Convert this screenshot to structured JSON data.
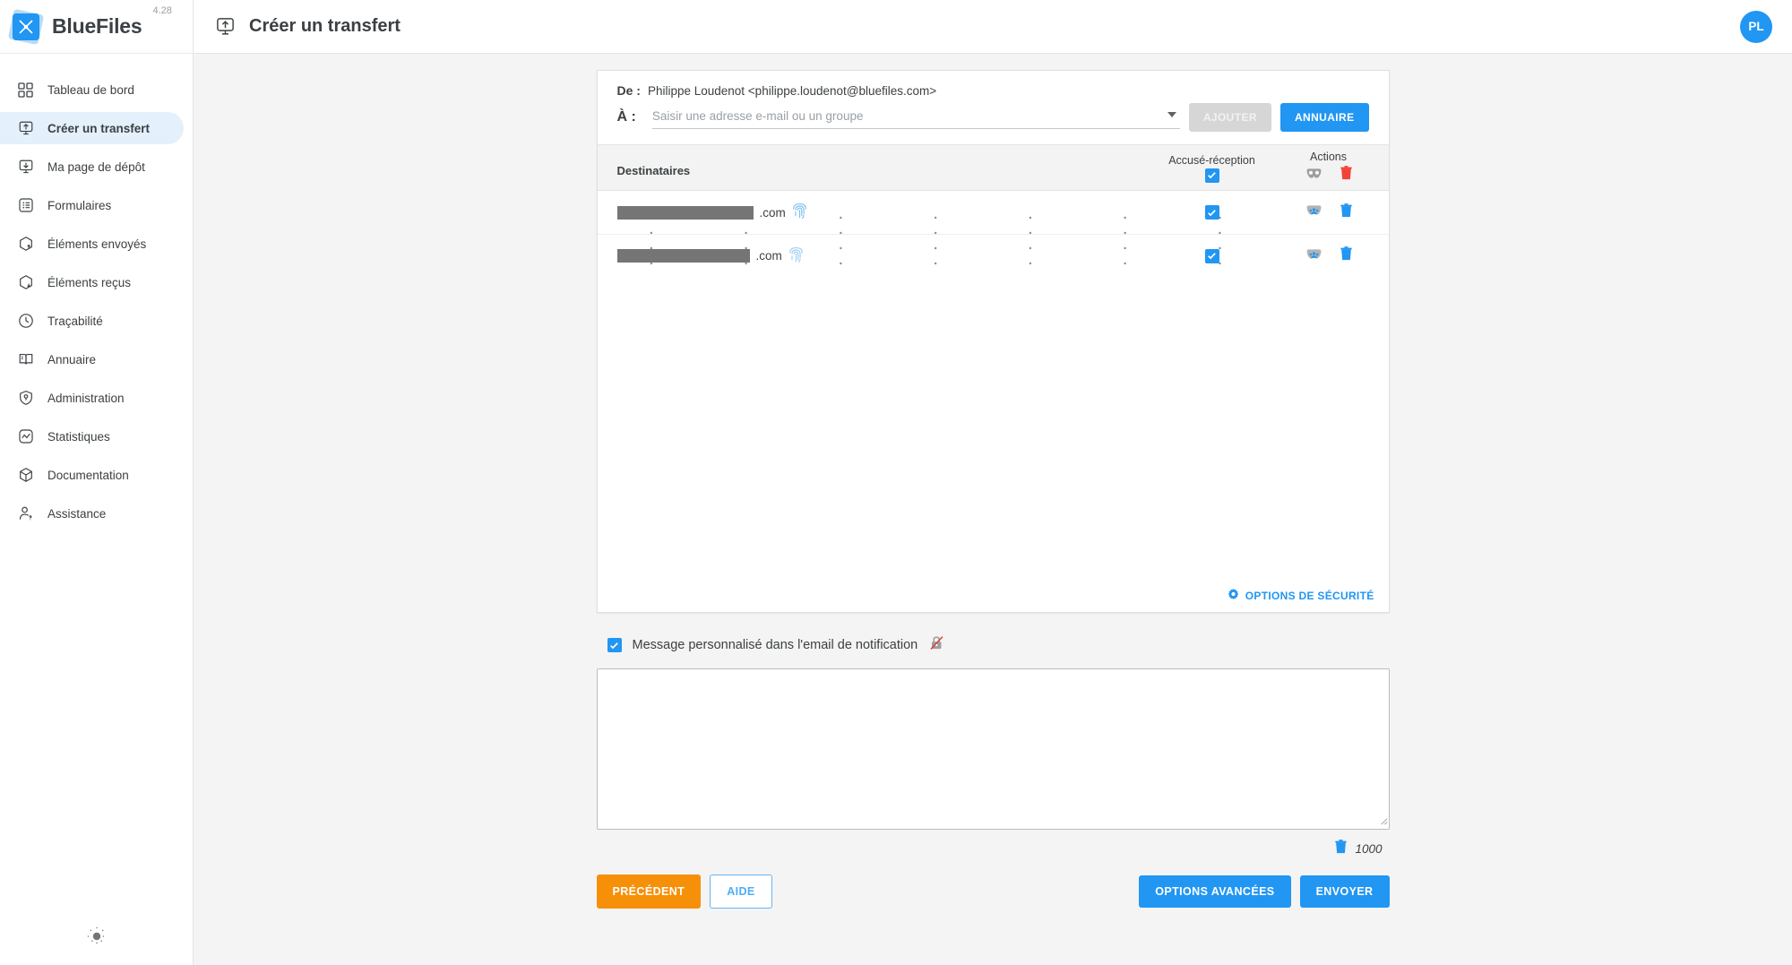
{
  "brand": {
    "name": "BlueFiles",
    "version": "4.28",
    "logo_icon": "bluefiles-x-logo"
  },
  "sidebar": {
    "items": [
      {
        "label": "Tableau de bord",
        "icon": "dashboard-grid-icon",
        "active": false
      },
      {
        "label": "Créer un transfert",
        "icon": "upload-monitor-icon",
        "active": true
      },
      {
        "label": "Ma page de dépôt",
        "icon": "download-monitor-icon",
        "active": false
      },
      {
        "label": "Formulaires",
        "icon": "list-form-icon",
        "active": false
      },
      {
        "label": "Éléments envoyés",
        "icon": "box-up-icon",
        "active": false
      },
      {
        "label": "Éléments reçus",
        "icon": "box-down-icon",
        "active": false
      },
      {
        "label": "Traçabilité",
        "icon": "clock-icon",
        "active": false
      },
      {
        "label": "Annuaire",
        "icon": "book-icon",
        "active": false
      },
      {
        "label": "Administration",
        "icon": "shield-key-icon",
        "active": false
      },
      {
        "label": "Statistiques",
        "icon": "chart-line-icon",
        "active": false
      },
      {
        "label": "Documentation",
        "icon": "cube-icon",
        "active": false
      },
      {
        "label": "Assistance",
        "icon": "user-question-icon",
        "active": false
      }
    ],
    "theme_toggle_icon": "sun-brightness-icon"
  },
  "topbar": {
    "icon": "upload-monitor-icon",
    "title": "Créer un transfert",
    "avatar_initials": "PL"
  },
  "transfer": {
    "from_label": "De :",
    "from_value": "Philippe Loudenot <philippe.loudenot@bluefiles.com>",
    "to_label": "À :",
    "to_placeholder": "Saisir une adresse e-mail ou un groupe",
    "to_value": "",
    "add_button": "AJOUTER",
    "directory_button": "ANNUAIRE",
    "dropdown_icon": "chevron-down-icon"
  },
  "table": {
    "col_recipients": "Destinataires",
    "col_receipt": "Accusé-réception",
    "col_actions": "Actions",
    "header_receipt_checked": true,
    "header_mask_icon": "mask-icon",
    "header_delete_icon": "trash-icon",
    "rows": [
      {
        "email_redacted": true,
        "email_suffix": ".com",
        "identity_icon": "fingerprint-icon",
        "receipt_checked": true,
        "mask_icon": "mask-people-icon",
        "delete_icon": "trash-icon"
      },
      {
        "email_redacted": true,
        "email_suffix": ".com",
        "identity_icon": "fingerprint-icon",
        "receipt_checked": true,
        "mask_icon": "mask-people-icon",
        "delete_icon": "trash-icon"
      }
    ],
    "security_options_label": "OPTIONS DE SÉCURITÉ",
    "security_options_icon": "gear-icon"
  },
  "message": {
    "checkbox_checked": true,
    "label": "Message personnalisé dans l'email de notification",
    "lock_icon": "lock-crossed-icon",
    "textarea_value": "",
    "counter": "1000",
    "counter_icon": "trash-icon"
  },
  "footer": {
    "previous": "PRÉCÉDENT",
    "help": "AIDE",
    "advanced_options": "OPTIONS AVANCÉES",
    "send": "ENVOYER"
  },
  "colors": {
    "accent_blue": "#2196f3",
    "orange": "#f79009",
    "red": "#f44336",
    "sidebar_active_bg": "#e4f0fb",
    "page_bg": "#f4f4f4"
  }
}
